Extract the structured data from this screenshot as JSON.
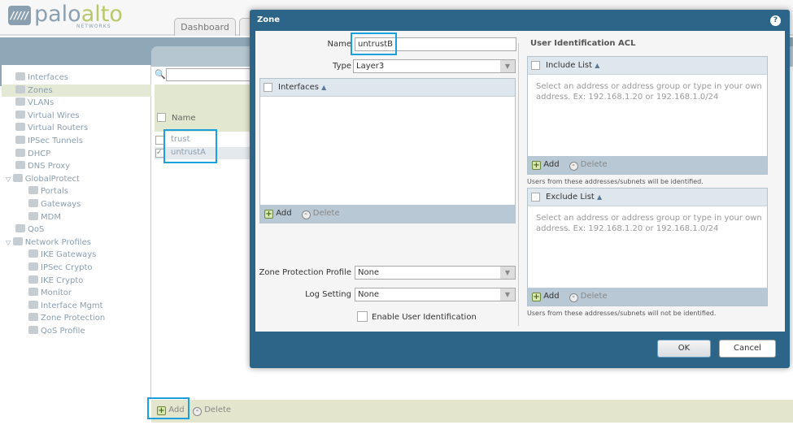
{
  "brand": {
    "mark": "/////",
    "palo": "palo",
    "alto": "alto",
    "networks": "NETWORKS"
  },
  "tabs": [
    "Dashboard",
    ""
  ],
  "sidebar": {
    "items": [
      {
        "label": "Interfaces",
        "icon": "interfaces-icon",
        "indent": 0
      },
      {
        "label": "Zones",
        "icon": "zones-icon",
        "indent": 0,
        "selected": true
      },
      {
        "label": "VLANs",
        "icon": "vlans-icon",
        "indent": 0
      },
      {
        "label": "Virtual Wires",
        "icon": "virtual-wires-icon",
        "indent": 0
      },
      {
        "label": "Virtual Routers",
        "icon": "virtual-routers-icon",
        "indent": 0
      },
      {
        "label": "IPSec Tunnels",
        "icon": "ipsec-tunnels-icon",
        "indent": 0
      },
      {
        "label": "DHCP",
        "icon": "dhcp-icon",
        "indent": 0
      },
      {
        "label": "DNS Proxy",
        "icon": "dns-proxy-icon",
        "indent": 0
      },
      {
        "label": "GlobalProtect",
        "icon": "globalprotect-icon",
        "indent": 0,
        "expanded": true
      },
      {
        "label": "Portals",
        "icon": "portals-icon",
        "indent": 1
      },
      {
        "label": "Gateways",
        "icon": "gateways-icon",
        "indent": 1
      },
      {
        "label": "MDM",
        "icon": "mdm-icon",
        "indent": 1
      },
      {
        "label": "QoS",
        "icon": "qos-icon",
        "indent": 0
      },
      {
        "label": "Network Profiles",
        "icon": "network-profiles-icon",
        "indent": 0,
        "expanded": true
      },
      {
        "label": "IKE Gateways",
        "icon": "ike-gateways-icon",
        "indent": 1
      },
      {
        "label": "IPSec Crypto",
        "icon": "ipsec-crypto-icon",
        "indent": 1
      },
      {
        "label": "IKE Crypto",
        "icon": "ike-crypto-icon",
        "indent": 1
      },
      {
        "label": "Monitor",
        "icon": "monitor-icon",
        "indent": 1
      },
      {
        "label": "Interface Mgmt",
        "icon": "interface-mgmt-icon",
        "indent": 1
      },
      {
        "label": "Zone Protection",
        "icon": "zone-protection-icon",
        "indent": 1
      },
      {
        "label": "QoS Profile",
        "icon": "qos-profile-icon",
        "indent": 1
      }
    ]
  },
  "zones_table": {
    "column": "Name",
    "rows": [
      {
        "name": "trust",
        "checked": false
      },
      {
        "name": "untrustA",
        "checked": true
      }
    ]
  },
  "bottom_bar": {
    "add": "Add",
    "delete": "Delete"
  },
  "dialog": {
    "title": "Zone",
    "help": "?",
    "name_label": "Name",
    "name_value": "untrustB",
    "type_label": "Type",
    "type_value": "Layer3",
    "interfaces": {
      "header": "Interfaces",
      "add": "Add",
      "delete": "Delete"
    },
    "zone_protection_label": "Zone Protection Profile",
    "zone_protection_value": "None",
    "log_setting_label": "Log Setting",
    "log_setting_value": "None",
    "enable_user_id": "Enable User Identification",
    "acl_title": "User Identification ACL",
    "include": {
      "header": "Include List",
      "hint": "Select an address or address group or type in your own address. Ex: 192.168.1.20 or 192.168.1.0/24",
      "add": "Add",
      "delete": "Delete",
      "note": "Users from these addresses/subnets will be identified."
    },
    "exclude": {
      "header": "Exclude List",
      "hint": "Select an address or address group or type in your own address. Ex: 192.168.1.20 or 192.168.1.0/24",
      "add": "Add",
      "delete": "Delete",
      "note": "Users from these addresses/subnets will not be identified."
    },
    "ok": "OK",
    "cancel": "Cancel"
  },
  "colors": {
    "dialog": "#2d6588",
    "highlight": "#1aa0dc",
    "selected_row": "#e4e9d6"
  }
}
